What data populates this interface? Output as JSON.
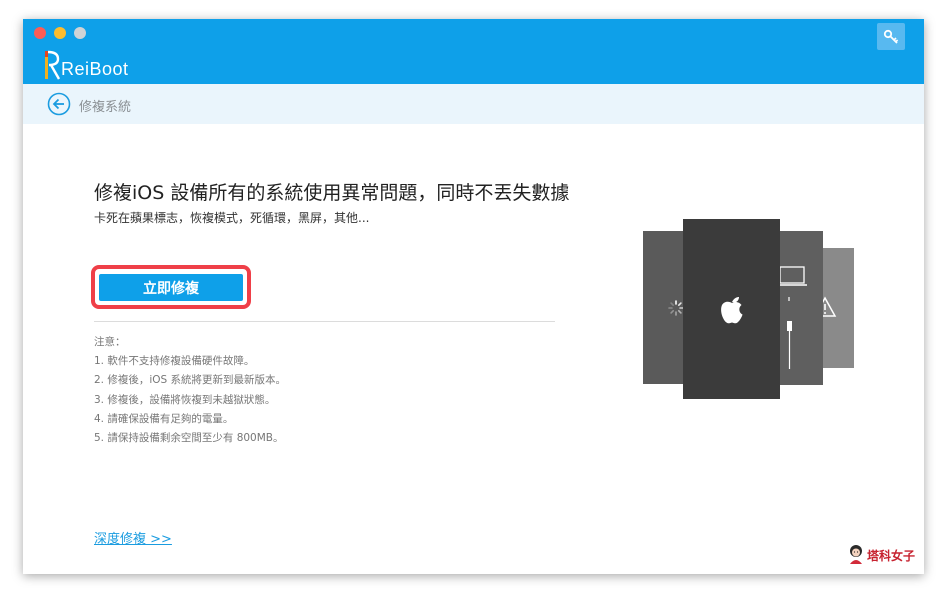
{
  "app": {
    "name": "ReiBoot",
    "colors": {
      "titlebar": "#0ea0e9",
      "accent": "#0ea0e9",
      "highlight_border": "#ef3f48",
      "link": "#1a9ce0"
    }
  },
  "window_controls": [
    "close",
    "minimize",
    "zoom"
  ],
  "header": {
    "key_icon": "key-icon"
  },
  "subheader": {
    "back_icon": "back-arrow-circle-icon",
    "title": "修複系統"
  },
  "main": {
    "headline": "修複iOS 設備所有的系統使用異常問題，同時不丟失數據",
    "subline": "卡死在蘋果標志，恢複模式，死循環，黑屏，其他...",
    "fix_button_label": "立即修複",
    "notes": {
      "title": "注意：",
      "items": [
        "1. 軟件不支持修複設備硬件故障。",
        "2. 修複後，iOS 系統將更新到最新版本。",
        "3. 修複後，設備將恢複到未越獄狀態。",
        "4. 請確保設備有足夠的電量。",
        "5. 請保持設備剩余空間至少有 800MB。"
      ]
    },
    "deep_repair_link": "深度修複 >>"
  },
  "illustration": {
    "screens": [
      "loading-spinner-icon",
      "apple-logo-icon",
      "laptop-cable-icon",
      "warning-icon"
    ]
  },
  "watermark": {
    "text": "塔科女子"
  }
}
